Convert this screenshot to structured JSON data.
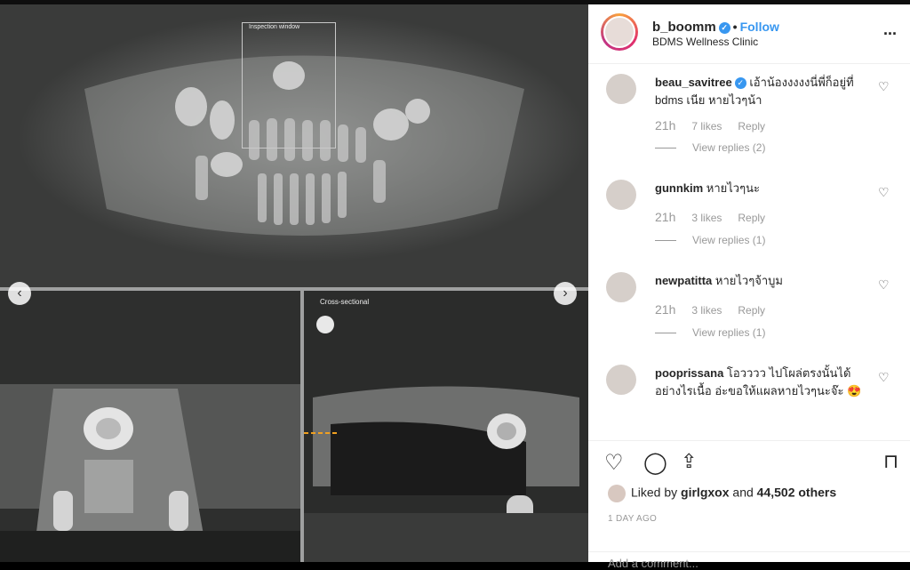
{
  "image": {
    "inspection_label": "Inspection window",
    "cross_label": "Cross-sectional",
    "prev_icon": "chevron-left-icon",
    "next_icon": "chevron-right-icon"
  },
  "header": {
    "username": "b_boomm",
    "verified_icon": "verified-check-icon",
    "dot": "•",
    "follow_label": "Follow",
    "location": "BDMS Wellness Clinic",
    "more_label": "..."
  },
  "comments": [
    {
      "user": "beau_savitree",
      "text": " เอ้าน้องงงงงนี่พี่ก็อยู่ที่ bdms เนีย หายไวๆน้า",
      "time": "21h",
      "likes": "7 likes",
      "reply": "Reply",
      "view_replies": "View replies (2)"
    },
    {
      "user": "gunnkim",
      "text": " หายไวๆนะ",
      "time": "21h",
      "likes": "3 likes",
      "reply": "Reply",
      "view_replies": "View replies (1)"
    },
    {
      "user": "newpatitta",
      "text": " หายไวๆจ้าบูม",
      "time": "21h",
      "likes": "3 likes",
      "reply": "Reply",
      "view_replies": "View replies (1)"
    },
    {
      "user": "pooprissana",
      "text": " โอวววว ไปโผล่ตรงนั้นได้อย่างไรเนื้อ อ่ะขอให้แผลหายไวๆนะจ๊ะ 😍"
    }
  ],
  "actions": {
    "liked_prefix": "Liked by ",
    "liked_user": "girlgxox",
    "liked_mid": " and ",
    "liked_count": "44,502 others",
    "date": "1 DAY AGO",
    "add_comment_placeholder": "Add a comment..."
  },
  "colors": {
    "link": "#3897f0",
    "text": "#262626",
    "muted": "#999999"
  }
}
